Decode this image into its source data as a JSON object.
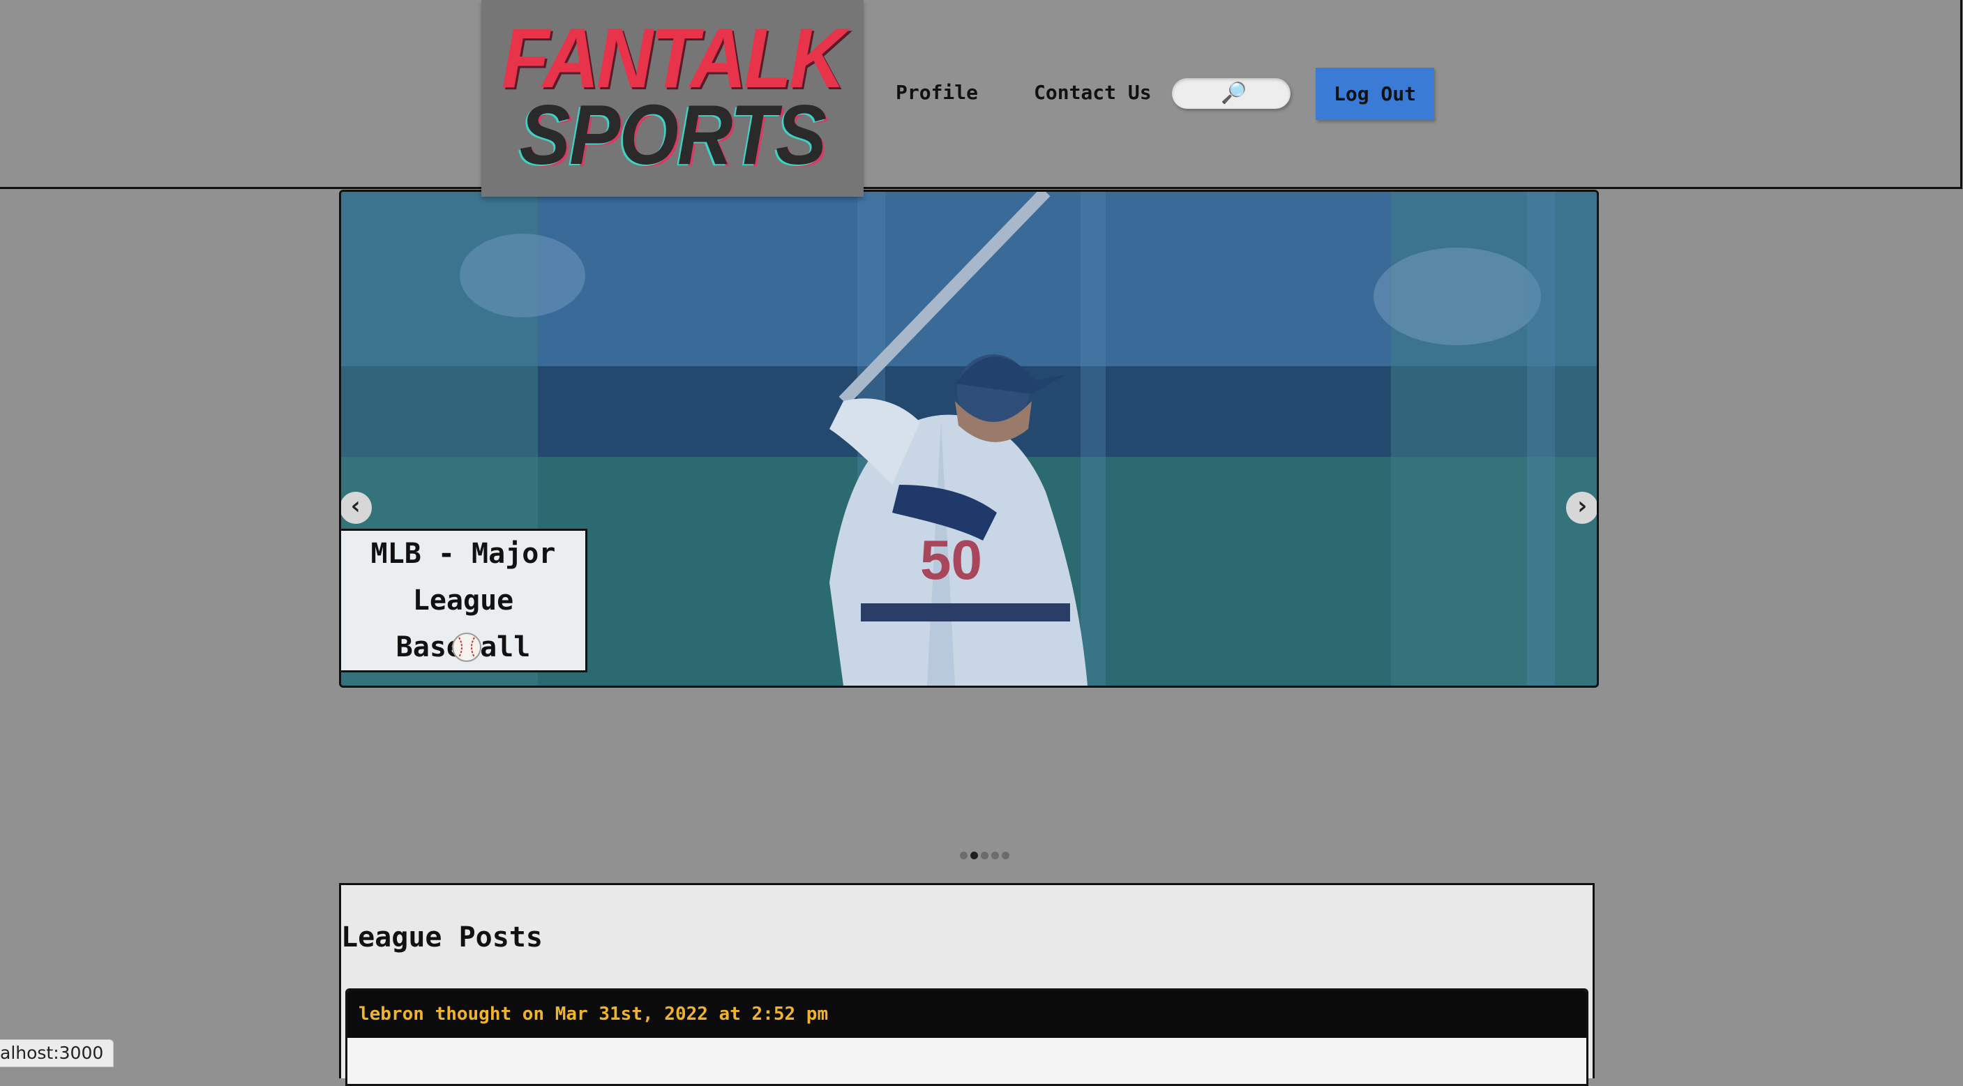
{
  "header": {
    "logo_line1": "FANTALK",
    "logo_line2": "SPORTS",
    "nav": {
      "profile": "Profile",
      "contact": "Contact Us"
    },
    "search": {
      "icon": "magnifier-icon",
      "glyph": "🔎"
    },
    "logout_label": "Log Out"
  },
  "carousel": {
    "prev_glyph": "‹",
    "next_glyph": "›",
    "caption_title": "MLB - Major League Baseball",
    "caption_emoji": "⚾",
    "active_index": 1,
    "slide_count": 5
  },
  "posts": {
    "title": "League Posts",
    "items": [
      {
        "header": "lebron thought on Mar 31st, 2022 at 2:52 pm"
      }
    ]
  },
  "status_bar": {
    "url": "alhost:3000"
  },
  "colors": {
    "background": "#919191",
    "logo_red": "#e8344b",
    "logout_blue": "#3a7bd5",
    "post_header_text": "#f0b429"
  }
}
